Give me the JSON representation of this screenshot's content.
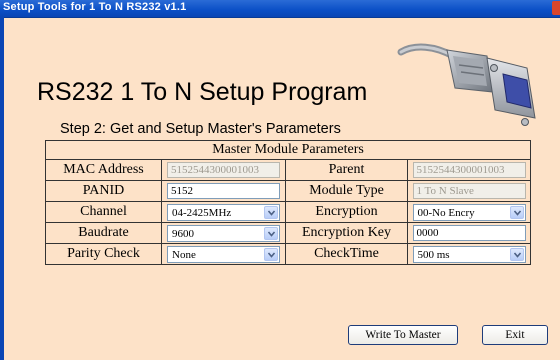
{
  "window": {
    "title": "Setup Tools for 1 To N  RS232 v1.1"
  },
  "heading": "RS232 1 To N Setup Program",
  "step": "Step 2: Get and Setup Master's Parameters",
  "table": {
    "header": "Master Module Parameters",
    "mac_label": "MAC Address",
    "mac_value": "5152544300001003",
    "parent_label": "Parent",
    "parent_value": "5152544300001003",
    "panid_label": "PANID",
    "panid_value": "5152",
    "module_type_label": "Module Type",
    "module_type_value": "1 To N Slave",
    "channel_label": "Channel",
    "channel_value": "04-2425MHz",
    "encryption_label": "Encryption",
    "encryption_value": "00-No Encry",
    "baudrate_label": "Baudrate",
    "baudrate_value": "9600",
    "encryption_key_label": "Encryption Key",
    "encryption_key_value": "0000",
    "parity_label": "Parity Check",
    "parity_value": "None",
    "checktime_label": "CheckTime",
    "checktime_value": "500 ms"
  },
  "buttons": {
    "write": "Write To Master",
    "exit": "Exit"
  },
  "icons": {
    "close": "close-icon",
    "dropdown": "chevron-down-icon",
    "cable": "serial-cable-icon"
  }
}
